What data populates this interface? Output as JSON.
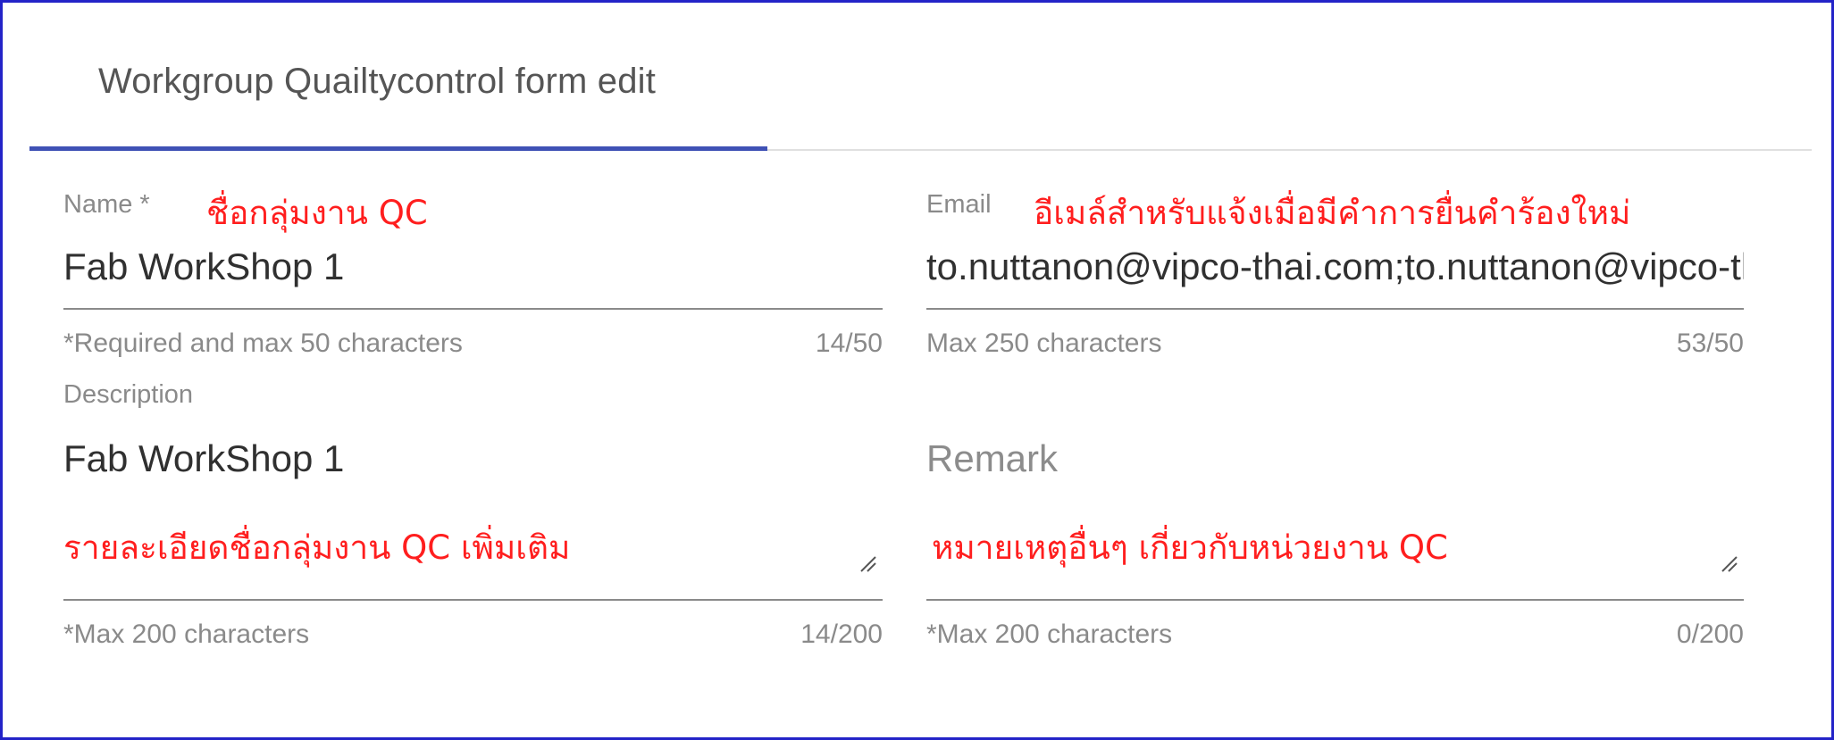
{
  "tab": {
    "label": "Workgroup Quailtycontrol form edit"
  },
  "accent_color": "#3f51b5",
  "annotation_color": "#ff1e1e",
  "fields": {
    "name": {
      "label": "Name *",
      "annotation": "ชื่อกลุ่มงาน QC",
      "value": "Fab WorkShop 1",
      "hint": "*Required and max 50 characters",
      "count": "14/50"
    },
    "email": {
      "label": "Email",
      "annotation": "อีเมล์สำหรับแจ้งเมื่อมีคำการยื่นคำร้องใหม่",
      "value": "to.nuttanon@vipco-thai.com;to.nuttanon@vipco-thai.com",
      "hint": "Max 250 characters",
      "count": "53/50"
    },
    "description": {
      "label": "Description",
      "annotation": "รายละเอียดชื่อกลุ่มงาน QC เพิ่มเติม",
      "value": "Fab WorkShop 1",
      "hint": "*Max 200 characters",
      "count": "14/200"
    },
    "remark": {
      "placeholder": "Remark",
      "annotation": "หมายเหตุอื่นๆ เกี่ยวกับหน่วยงาน QC",
      "value": "",
      "hint": "*Max 200 characters",
      "count": "0/200"
    }
  }
}
